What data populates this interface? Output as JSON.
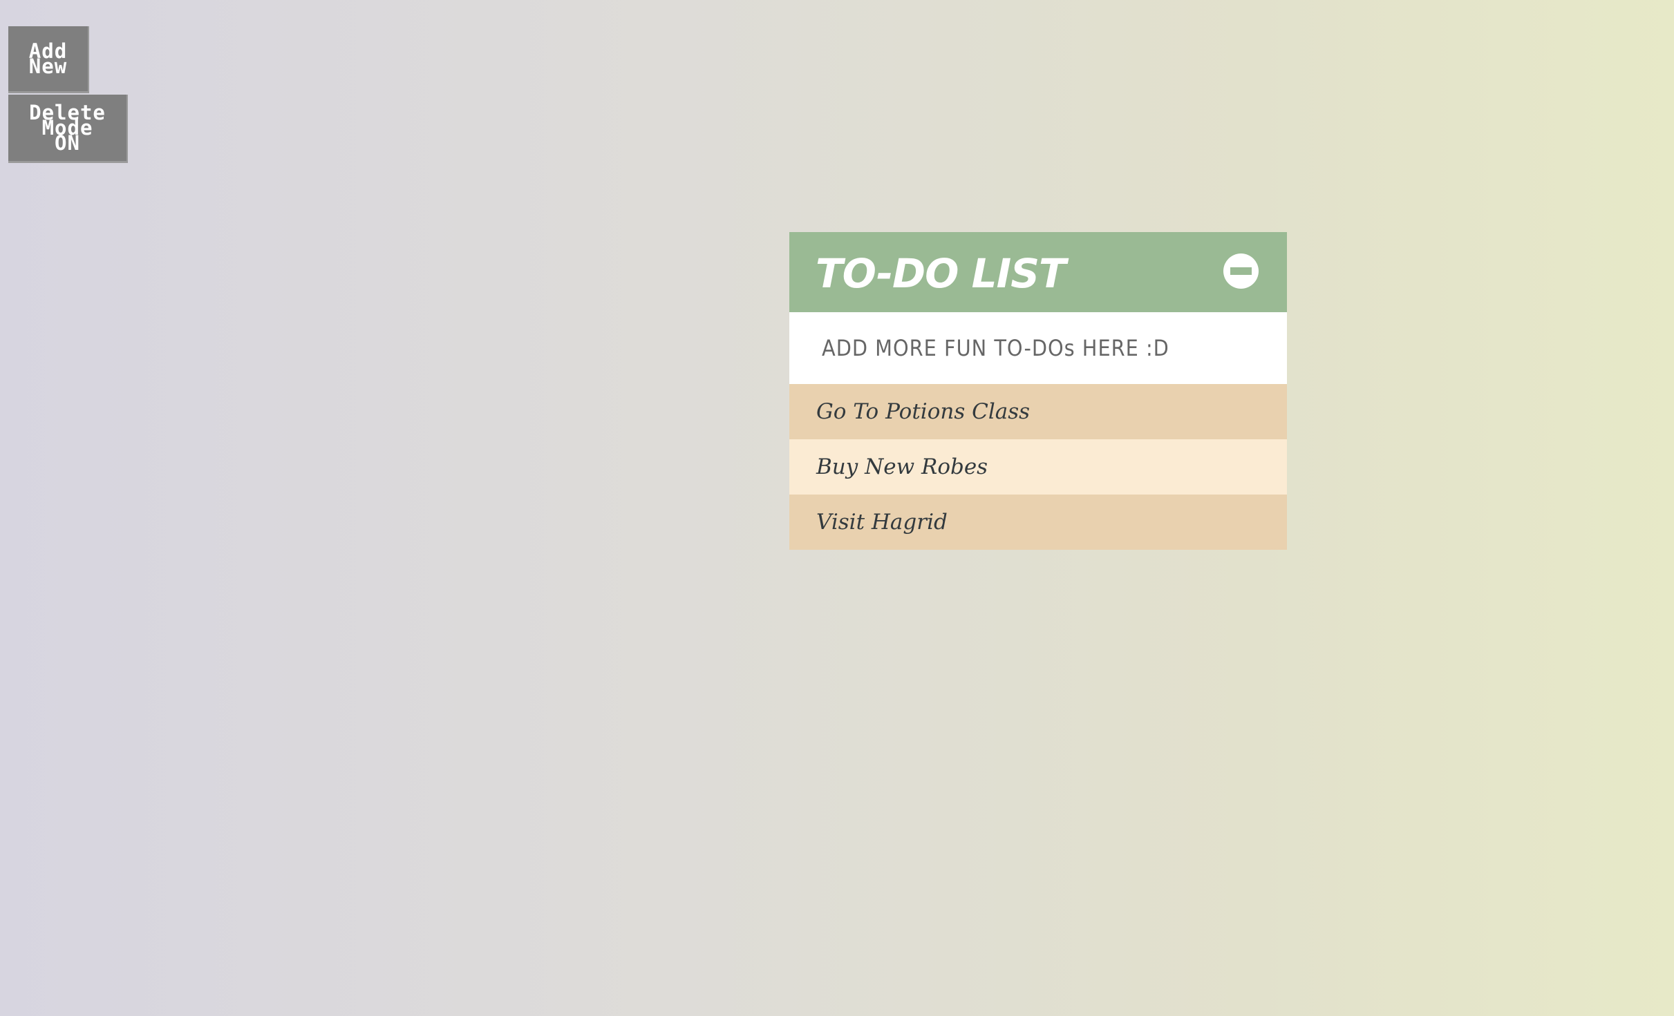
{
  "controls": {
    "add_new_label": "Add\nNew",
    "delete_mode_label": "Delete\nMode\nON"
  },
  "todo": {
    "title": "TO-DO LIST",
    "toggle_icon": "minus-circle-icon",
    "input_placeholder": "ADD MORE FUN TO-DOs HERE :D",
    "input_value": "",
    "items": [
      {
        "label": "Go To Potions Class"
      },
      {
        "label": "Buy New Robes"
      },
      {
        "label": "Visit Hagrid"
      }
    ]
  },
  "colors": {
    "header": "#9aba94",
    "item_odd": "#e9d1af",
    "item_even": "#fbebd3",
    "button": "#7f7f7f"
  }
}
